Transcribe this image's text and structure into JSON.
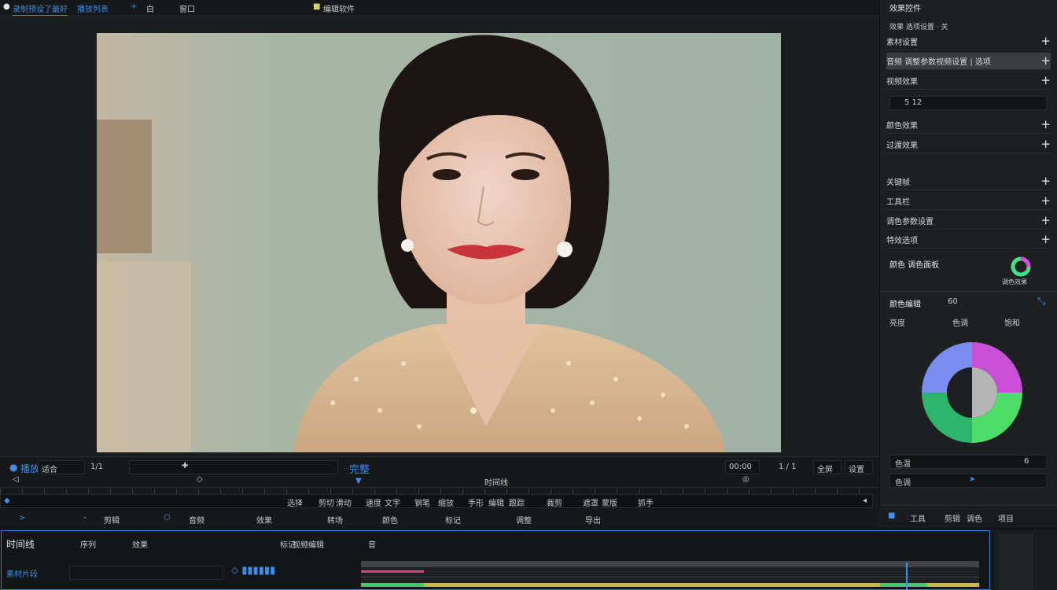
{
  "menu": {
    "tab1": "录制预设了最好",
    "tab2": "播放列表",
    "item_size": "白",
    "item_window": "窗口",
    "item_edit": "编辑软件"
  },
  "right_panel": {
    "header": "效果控件",
    "subheader": "效果 选项设置 · 关",
    "rows": [
      {
        "label": "素材设置",
        "action": "+"
      },
      {
        "label": "音频 调整参数视频设置 | 选项",
        "action": "+"
      },
      {
        "label": "视频效果",
        "action": "+"
      },
      {
        "label": "5 12",
        "action": ""
      },
      {
        "label": "颜色效果",
        "action": "+"
      },
      {
        "label": "过渡效果",
        "action": "+"
      },
      {
        "label": "关键帧",
        "action": "+"
      },
      {
        "label": "工具栏",
        "action": "+"
      },
      {
        "label": "调色参数设置",
        "action": "+"
      },
      {
        "label": "特效选项",
        "action": "+"
      }
    ],
    "color_section": {
      "title": "颜色 调色面板",
      "badge": "调色效果",
      "panel_title": "颜色编辑",
      "value": "60",
      "sub_labels": [
        "亮度",
        "色调",
        "饱和"
      ],
      "readouts": [
        {
          "label": "色温",
          "value": "6"
        },
        {
          "label": "色调",
          "value": ""
        }
      ]
    },
    "bottom_tabs": [
      "工具",
      "剪辑",
      "调色",
      "项目"
    ]
  },
  "viewer_controls": {
    "left_label": "播放",
    "fit_label": "适合",
    "page": "1/1",
    "center_label": "完整",
    "right_label1": "00:00",
    "right_label2": "1 / 1",
    "right_label3": "全屏",
    "right_label4": "设置",
    "ruler_label": "时间线",
    "tool_labels": [
      "选择",
      "剪切",
      "滑动",
      "速度",
      "文字",
      "钢笔",
      "缩放",
      "手形",
      "编辑",
      "跟踪",
      "裁剪",
      "遮罩",
      "蒙版",
      "抓手"
    ],
    "row3_labels": [
      "剪辑",
      "音频",
      "效果",
      "转场",
      "颜色",
      "标记",
      "调整",
      "导出"
    ]
  },
  "timeline": {
    "title": "时间线",
    "tab1": "序列",
    "tab2": "效果",
    "tab3": "标记",
    "tab4": "视频编辑",
    "tab5": "音",
    "source_label": "素材片段"
  },
  "colors": {
    "accent": "#3d8ee6",
    "panel_bg": "#1e1f21",
    "highlight": "#3a3c40"
  }
}
